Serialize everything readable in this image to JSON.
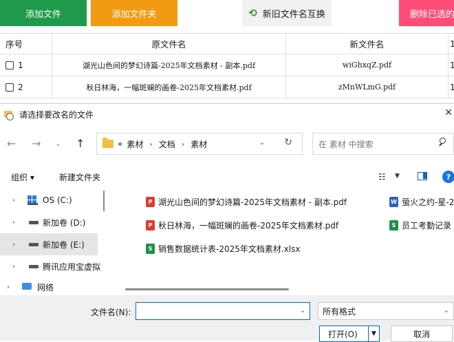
{
  "toolbar": {
    "add_file": "添加文件",
    "add_folder": "添加文件夹",
    "swap_names": "新旧文件名互换",
    "delete_selected": "删除已选的",
    "colors": {
      "add_file": "#1f9a4a",
      "add_folder": "#f29a12",
      "delete": "#ff4d7a"
    }
  },
  "grid": {
    "headers": {
      "index": "序号",
      "old_name": "原文件名",
      "new_name": "新文件名",
      "extra": "1"
    },
    "rows": [
      {
        "index": "1",
        "old_name": "湖光山色间的梦幻诗篇-2025年文档素材 - 副本.pdf",
        "new_name": "wiGhxqZ.pdf",
        "extra": "1"
      },
      {
        "index": "2",
        "old_name": "秋日林海，一幅斑斓的画卷-2025年文档素材.pdf",
        "new_name": "zMnWLmG.pdf",
        "extra": "1"
      }
    ]
  },
  "dialog": {
    "title": "请选择要改名的文件",
    "close_icon": "close-icon",
    "address": {
      "overflow": "«",
      "crumbs": [
        "素材",
        "文档",
        "素材"
      ]
    },
    "search_placeholder": "在 素材 中搜索",
    "commands": {
      "organize": "组织 ▾",
      "new_folder": "新建文件夹"
    },
    "tree": [
      {
        "label": "OS (C:)",
        "icon": "os-drive-icon"
      },
      {
        "label": "新加卷 (D:)",
        "icon": "drive-icon"
      },
      {
        "label": "新加卷 (E:)",
        "icon": "drive-icon",
        "selected": true
      },
      {
        "label": "腾讯应用宝虚拟",
        "icon": "drive-icon"
      },
      {
        "label": "网络",
        "icon": "network-icon"
      }
    ],
    "files": [
      {
        "name": "湖光山色间的梦幻诗篇-2025年文档素材 - 副本.pdf",
        "type": "pdf"
      },
      {
        "name": "萤火之约-星-2",
        "type": "word"
      },
      {
        "name": "秋日林海，一幅斑斓的画卷-2025年文档素材.pdf",
        "type": "pdf"
      },
      {
        "name": "员工考勤记录",
        "type": "xlsx"
      },
      {
        "name": "销售数据统计表-2025年文档素材.xlsx",
        "type": "xlsx"
      }
    ],
    "footer": {
      "filename_label": "文件名(N):",
      "filename_value": "",
      "filter_value": "所有格式",
      "open_label": "打开(O)",
      "cancel_label": "取消"
    }
  }
}
